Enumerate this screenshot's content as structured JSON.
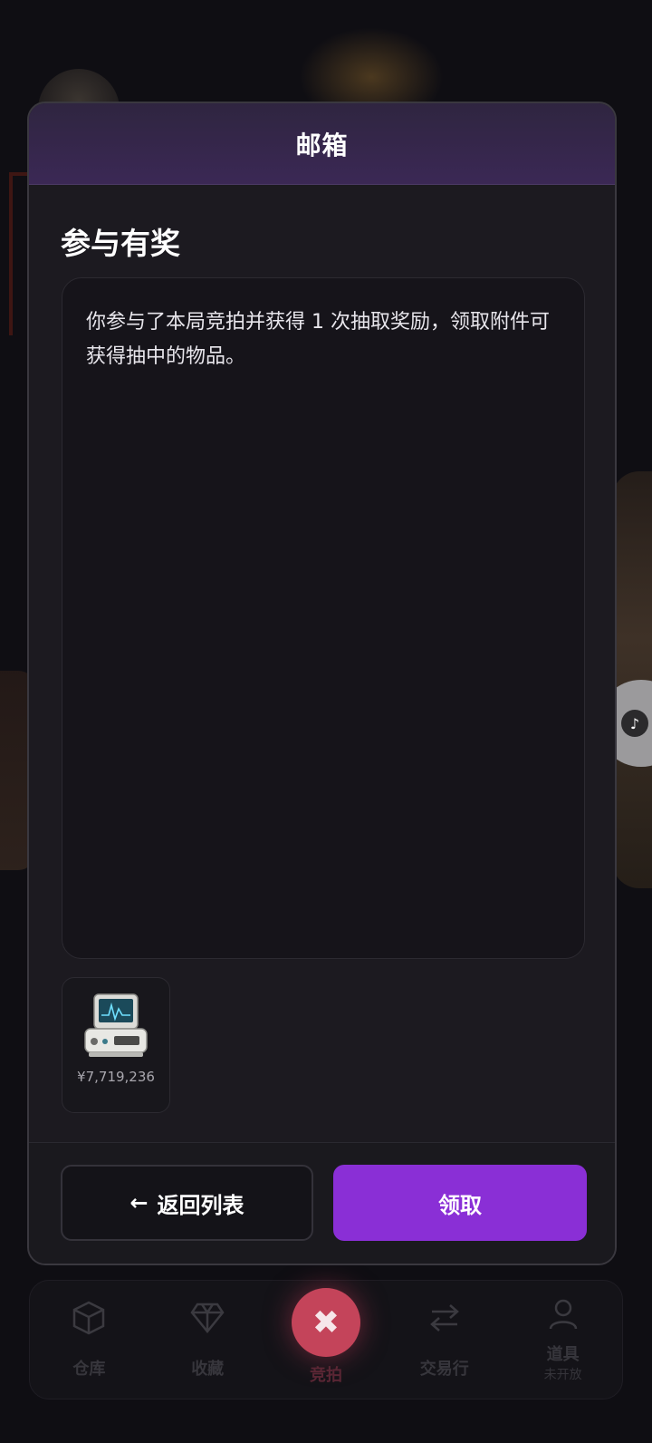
{
  "modal": {
    "title": "邮箱",
    "mail_title": "参与有奖",
    "mail_body": "你参与了本局竞拍并获得 1 次抽取奖励，领取附件可获得抽中的物品。",
    "attachment": {
      "icon": "medical-monitor-icon",
      "price": "¥7,719,236"
    },
    "back_arrow": "←",
    "back_label": "返回列表",
    "claim_label": "领取"
  },
  "bottom_nav": {
    "items": [
      {
        "icon": "box-icon",
        "label": "仓库"
      },
      {
        "icon": "diamond-icon",
        "label": "收藏"
      },
      {
        "icon": "close-icon",
        "label": "竞拍",
        "glyph": "✖"
      },
      {
        "icon": "swap-arrows-icon",
        "label": "交易行"
      },
      {
        "icon": "user-icon",
        "label": "道具",
        "sub": "未开放"
      }
    ]
  },
  "colors": {
    "accent": "#8a2fd6",
    "header": "#3b2855",
    "nav_center": "#c4445a"
  }
}
